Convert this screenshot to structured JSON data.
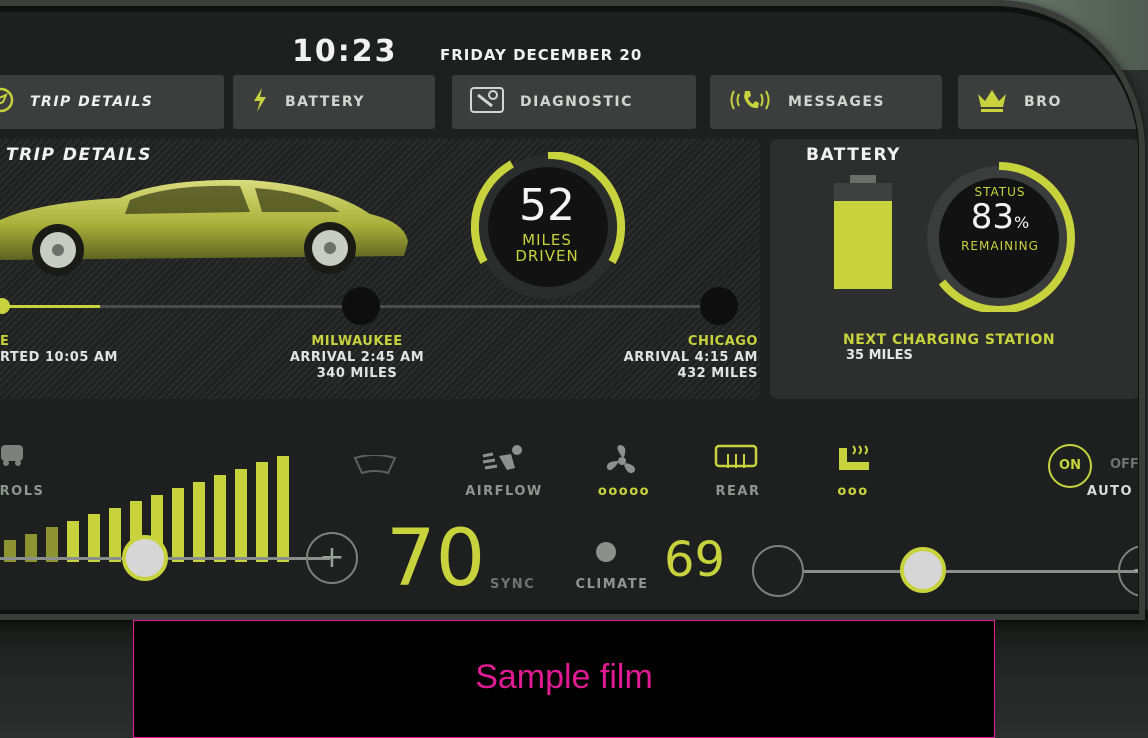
{
  "header": {
    "time": "10:23",
    "date": "FRIDAY DECEMBER 20"
  },
  "tabs": [
    {
      "label": "TRIP DETAILS",
      "icon": "compass-icon",
      "active": true
    },
    {
      "label": "BATTERY",
      "icon": "lightning-icon"
    },
    {
      "label": "DIAGNOSTIC",
      "icon": "wrench-icon"
    },
    {
      "label": "MESSAGES",
      "icon": "phone-icon"
    },
    {
      "label": "BRO",
      "icon": "crown-icon"
    }
  ],
  "trip": {
    "title": "TRIP DETAILS",
    "miles": "52",
    "miles_label_1": "MILES",
    "miles_label_2": "DRIVEN",
    "stops": [
      {
        "name": "E",
        "line1": "RTED 10:05 AM",
        "line2": ""
      },
      {
        "name": "MILWAUKEE",
        "line1": "ARRIVAL 2:45 AM",
        "line2": "340 MILES"
      },
      {
        "name": "CHICAGO",
        "line1": "ARRIVAL 4:15 AM",
        "line2": "432 MILES"
      }
    ]
  },
  "battery": {
    "title": "BATTERY",
    "status_label": "STATUS",
    "percent": "83",
    "percent_sign": "%",
    "remaining_label": "REMAINING",
    "level": 0.83,
    "next_station_label": "NEXT CHARGING STATION",
    "next_station_distance": "35 MILES"
  },
  "climate": {
    "controls": [
      {
        "label": "ROLS",
        "icon": "car-icon"
      },
      {
        "label": "",
        "icon": "defrost-icon"
      },
      {
        "label": "AIRFLOW",
        "icon": "airflow-icon"
      },
      {
        "label": "ooooo",
        "icon": "fan-icon"
      },
      {
        "label": "REAR",
        "icon": "rear-defrost-icon"
      },
      {
        "label": "ooo",
        "icon": "seat-heat-icon"
      }
    ],
    "auto_on": "ON",
    "auto_off": "OFF",
    "auto_label": "AUTO",
    "driver_temp": "70",
    "sync_label": "SYNC",
    "climate_label": "CLIMATE",
    "passenger_temp": "69",
    "plus": "+"
  },
  "overlay": {
    "film_text": "Sample film"
  },
  "colors": {
    "accent": "#c7d23d",
    "film": "#e01a92"
  }
}
